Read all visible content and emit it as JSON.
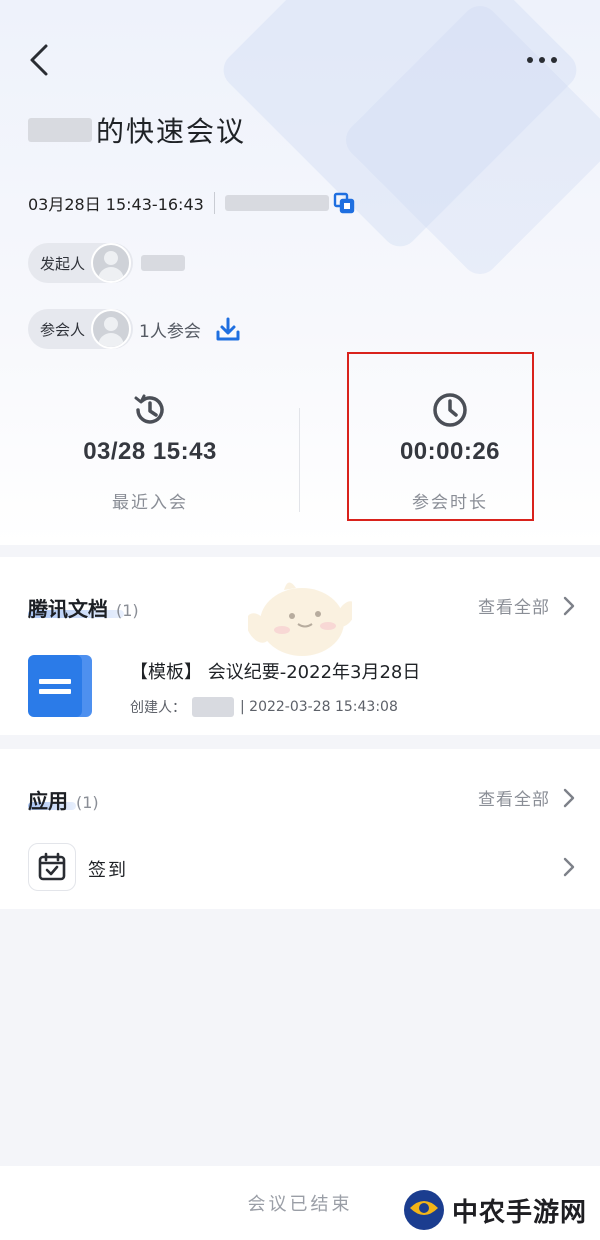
{
  "header": {
    "title": "的快速会议",
    "time_range": "03月28日 15:43-16:43",
    "initiator_label": "发起人",
    "participants_label": "参会人",
    "participants_count": "1人参会"
  },
  "stats": [
    {
      "value": "03/28 15:43",
      "label": "最近入会",
      "icon": "history-clock-icon"
    },
    {
      "value": "00:00:26",
      "label": "参会时长",
      "icon": "clock-icon"
    }
  ],
  "docs": {
    "title": "腾讯文档",
    "count": "(1)",
    "view_all": "查看全部",
    "items": [
      {
        "name": "【模板】 会议纪要-2022年3月28日",
        "creator_label": "创建人：",
        "created_at": "| 2022-03-28 15:43:08"
      }
    ]
  },
  "apps": {
    "title": "应用",
    "count": "(1)",
    "view_all": "查看全部",
    "items": [
      {
        "name": "签到",
        "icon": "check-in-calendar-icon"
      }
    ]
  },
  "footer": {
    "status": "会议已结束"
  },
  "watermark": {
    "text": "中农手游网"
  },
  "colors": {
    "accent": "#1f6fe0",
    "highlight_box": "#d9221c",
    "doc_blue": "#2b7be8"
  }
}
